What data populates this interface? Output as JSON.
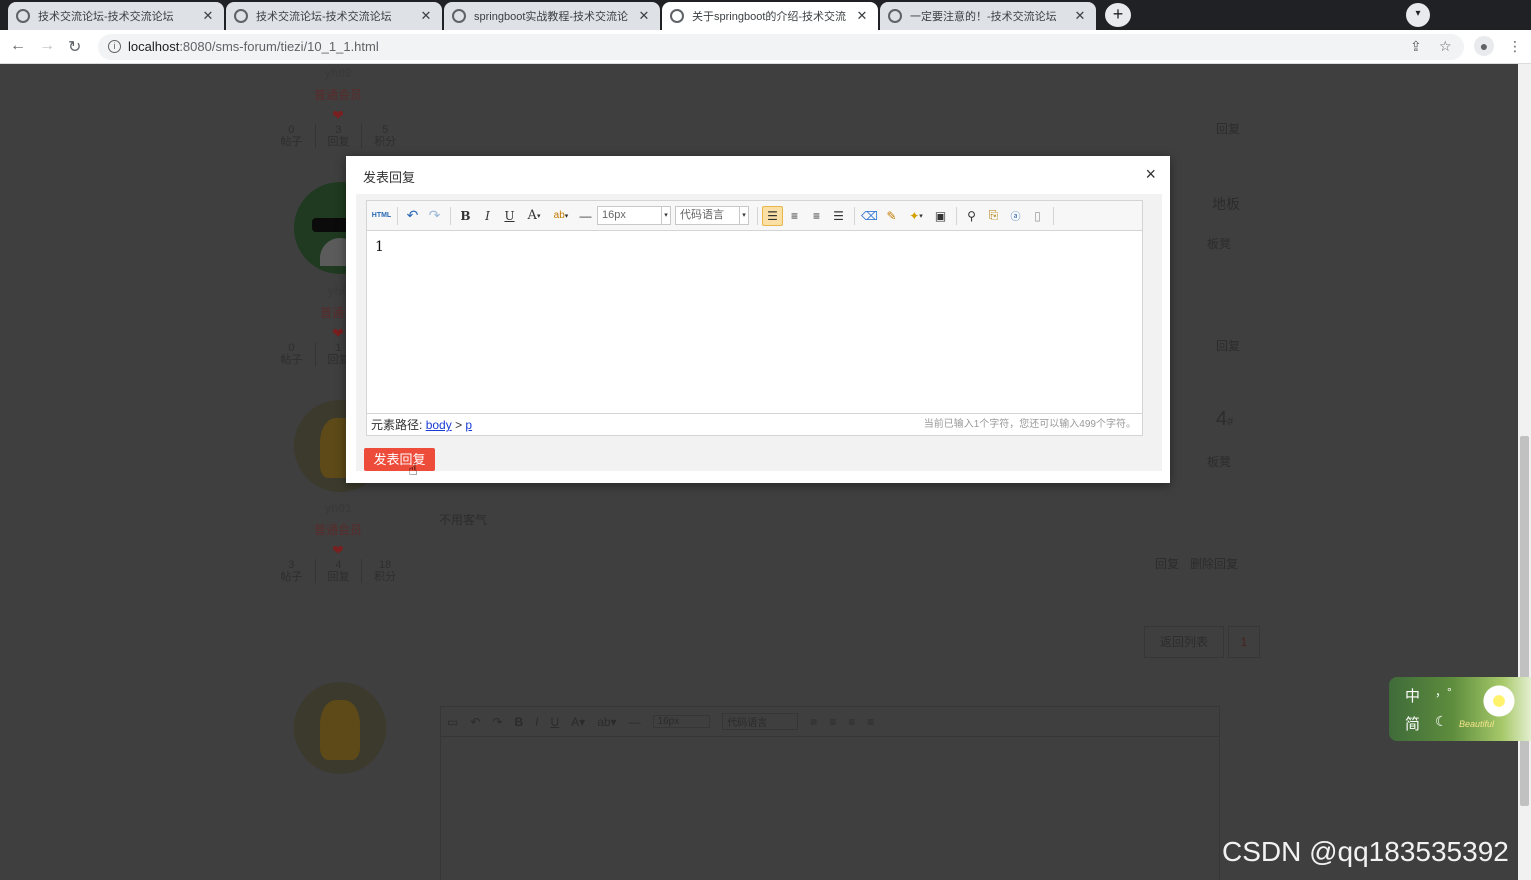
{
  "browser": {
    "tabs": [
      {
        "title": "技术交流论坛-技术交流论坛"
      },
      {
        "title": "技术交流论坛-技术交流论坛"
      },
      {
        "title": "springboot实战教程-技术交流论"
      },
      {
        "title": "关于springboot的介绍-技术交流"
      },
      {
        "title": "一定要注意的！-技术交流论坛"
      }
    ],
    "url_host": "localhost",
    "url_path": ":8080/sms-forum/tiezi/10_1_1.html"
  },
  "background": {
    "users": [
      {
        "name": "yh02",
        "level": "普通会员",
        "posts": "0",
        "posts_label": "帖子",
        "replies": "3",
        "replies_label": "回复",
        "points": "5",
        "points_label": "积分"
      },
      {
        "name": "yh0",
        "level": "普通会",
        "posts": "0",
        "posts_label": "帖子",
        "replies": "1",
        "replies_label": "回复",
        "points": "",
        "points_label": ""
      },
      {
        "name": "yh01",
        "level": "普通会员",
        "posts": "3",
        "posts_label": "帖子",
        "replies": "4",
        "replies_label": "回复",
        "points": "18",
        "points_label": "积分"
      }
    ],
    "reply_label": "回复",
    "floor_label": "地板",
    "board_label": "板凳",
    "floor_number": "4",
    "floor_suffix": "#",
    "reply_text": "不用客气",
    "actions": {
      "reply": "回复",
      "delete": "删除回复"
    },
    "back_to_list": "返回列表",
    "page_number": "1",
    "font_size": "16px",
    "code_lang": "代码语言"
  },
  "modal": {
    "title": "发表回复",
    "close_glyph": "×",
    "editor": {
      "font_size": "16px",
      "code_language": "代码语言",
      "content": "1",
      "path_label": "元素路径:",
      "path_body": "body",
      "path_sep": ">",
      "path_p": "p",
      "char_count": "当前已输入1个字符，您还可以输入499个字符。"
    },
    "submit_label": "发表回复"
  },
  "ime": {
    "lang": "中",
    "punct": "，°",
    "mode": "简",
    "moon": "☾",
    "brand": "Beautiful"
  },
  "watermark": "CSDN @qq183535392"
}
